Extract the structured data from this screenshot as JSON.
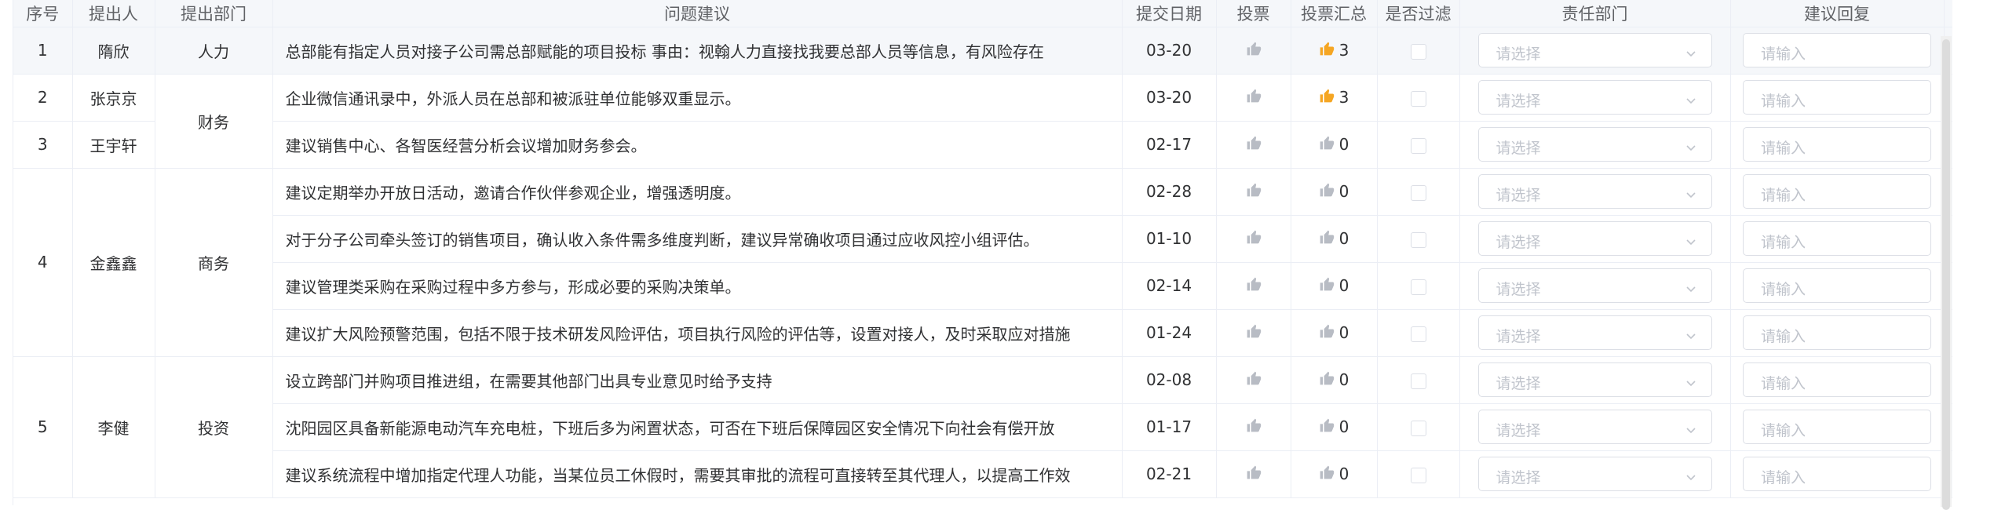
{
  "headers": {
    "seq": "序号",
    "proposer": "提出人",
    "dept": "提出部门",
    "suggestion": "问题建议",
    "date": "提交日期",
    "vote": "投票",
    "vote_total": "投票汇总",
    "filtered": "是否过滤",
    "resp_dept": "责任部门",
    "reply": "建议回复"
  },
  "placeholders": {
    "select": "请选择",
    "input": "请输入"
  },
  "colors": {
    "thumb_active": "#f5a623",
    "thumb_inactive": "#b8bcc4"
  },
  "groups": [
    {
      "seq": "1",
      "name": "隋欣",
      "dept": "人力"
    },
    {
      "seq": "2",
      "name": "张京京",
      "dept": "财务"
    },
    {
      "seq": "3",
      "name": "王宇轩",
      "dept": ""
    },
    {
      "seq": "4",
      "name": "金鑫鑫",
      "dept": "商务"
    },
    {
      "seq": "5",
      "name": "李健",
      "dept": "投资"
    }
  ],
  "rows": [
    {
      "text": "总部能有指定人员对接子公司需总部赋能的项目投标 事由：视翰人力直接找我要总部人员等信息，有风险存在",
      "date": "03-20",
      "total": "3",
      "active": true
    },
    {
      "text": "企业微信通讯录中，外派人员在总部和被派驻单位能够双重显示。",
      "date": "03-20",
      "total": "3",
      "active": true
    },
    {
      "text": "建议销售中心、各智医经营分析会议增加财务参会。",
      "date": "02-17",
      "total": "0",
      "active": false
    },
    {
      "text": "建议定期举办开放日活动，邀请合作伙伴参观企业，增强透明度。",
      "date": "02-28",
      "total": "0",
      "active": false
    },
    {
      "text": "对于分子公司牵头签订的销售项目，确认收入条件需多维度判断，建议异常确收项目通过应收风控小组评估。",
      "date": "01-10",
      "total": "0",
      "active": false
    },
    {
      "text": "建议管理类采购在采购过程中多方参与，形成必要的采购决策单。",
      "date": "02-14",
      "total": "0",
      "active": false
    },
    {
      "text": "建议扩大风险预警范围，包括不限于技术研发风险评估，项目执行风险的评估等，设置对接人，及时采取应对措施",
      "date": "01-24",
      "total": "0",
      "active": false
    },
    {
      "text": "设立跨部门并购项目推进组，在需要其他部门出具专业意见时给予支持",
      "date": "02-08",
      "total": "0",
      "active": false
    },
    {
      "text": "沈阳园区具备新能源电动汽车充电桩，下班后多为闲置状态，可否在下班后保障园区安全情况下向社会有偿开放",
      "date": "01-17",
      "total": "0",
      "active": false
    },
    {
      "text": "建议系统流程中增加指定代理人功能，当某位员工休假时，需要其审批的流程可直接转至其代理人，以提高工作效",
      "date": "02-21",
      "total": "0",
      "active": false
    }
  ]
}
